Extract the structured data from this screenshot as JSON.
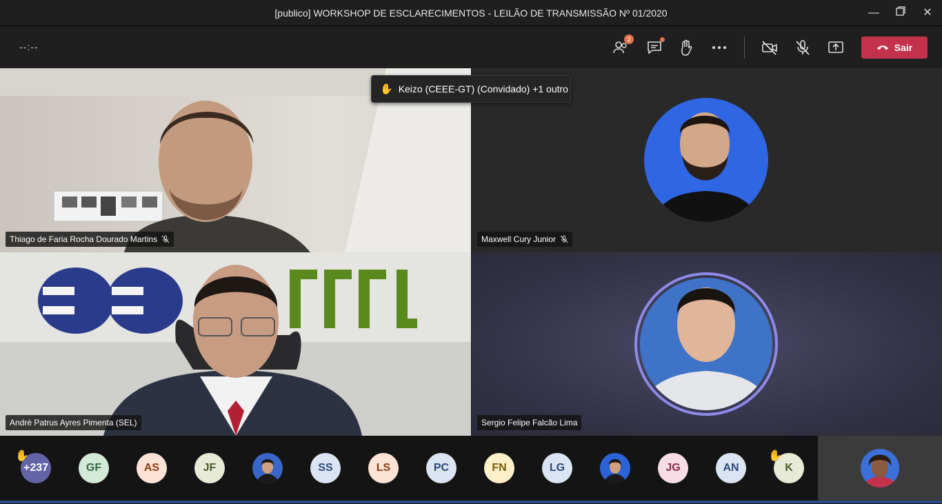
{
  "window": {
    "title": "[publico] WORKSHOP DE ESCLARECIMENTOS - LEILÃO DE TRANSMISSÃO Nº 01/2020",
    "minimize_icon": "minimize-icon",
    "restore_icon": "restore-icon",
    "close_icon": "close-icon"
  },
  "toolbar": {
    "timer": "--:--",
    "participants_badge": "2",
    "leave_label": "Sair"
  },
  "raise_toast": {
    "text": "Keizo (CEEE-GT) (Convidado) +1 outro"
  },
  "tiles": [
    {
      "name": "Thiago de Faria Rocha Dourado Martins",
      "muted": true
    },
    {
      "name": "Maxwell Cury Junior",
      "muted": true
    },
    {
      "name": "André Patrus Ayres Pimenta (SEL)",
      "muted": false
    },
    {
      "name": "Sergio Felipe Falcão Lima",
      "muted": false
    }
  ],
  "roster": [
    {
      "initials": "+237",
      "bg": "#6264a7",
      "fg": "#ffffff",
      "hand": true
    },
    {
      "initials": "GF",
      "bg": "#d3ead9",
      "fg": "#2f6b3c"
    },
    {
      "initials": "AS",
      "bg": "#fde3d6",
      "fg": "#8a3b16"
    },
    {
      "initials": "JF",
      "bg": "#e6ead6",
      "fg": "#4d5a2a"
    },
    {
      "initials": "",
      "bg": "#3a66c8",
      "photo": true
    },
    {
      "initials": "SS",
      "bg": "#dbe4f2",
      "fg": "#2b4a7a"
    },
    {
      "initials": "LS",
      "bg": "#fde3d6",
      "fg": "#8a3b16"
    },
    {
      "initials": "PC",
      "bg": "#dbe4f2",
      "fg": "#2b4a7a"
    },
    {
      "initials": "FN",
      "bg": "#fdf0c8",
      "fg": "#7a5a0a"
    },
    {
      "initials": "LG",
      "bg": "#dbe4f2",
      "fg": "#2b4a7a"
    },
    {
      "initials": "",
      "bg": "#2a63d6",
      "photo": true
    },
    {
      "initials": "JG",
      "bg": "#f8dde6",
      "fg": "#8a2b4a"
    },
    {
      "initials": "AN",
      "bg": "#dbe4f2",
      "fg": "#2b4a7a"
    },
    {
      "initials": "K",
      "bg": "#e6ead6",
      "fg": "#4d5a2a",
      "hand": true
    }
  ]
}
